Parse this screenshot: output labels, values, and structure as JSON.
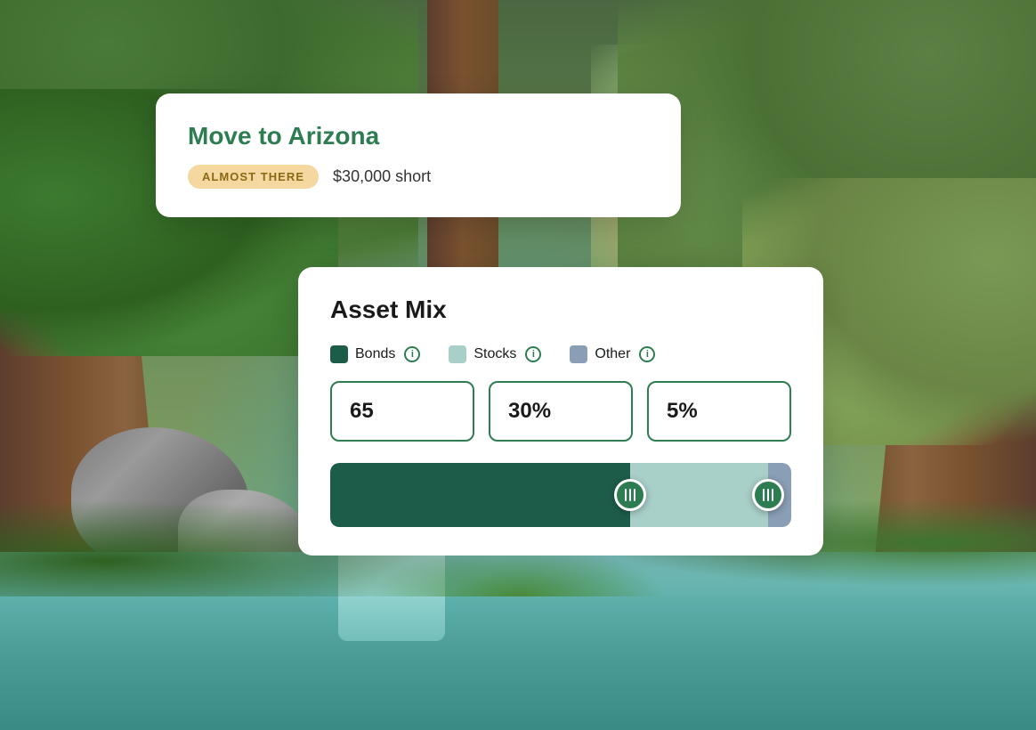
{
  "background": {
    "alt": "Forest with waterfall background"
  },
  "goal_card": {
    "title": "Move to Arizona",
    "status_badge": "ALMOST THERE",
    "short_amount": "$30,000 short"
  },
  "asset_card": {
    "title": "Asset Mix",
    "legend": {
      "bonds_label": "Bonds",
      "stocks_label": "Stocks",
      "other_label": "Other"
    },
    "bonds_value": "65",
    "stocks_value": "30%",
    "other_value": "5%",
    "bonds_pct": 65,
    "stocks_pct": 30,
    "other_pct": 5,
    "info_symbol": "i",
    "bonds_color": "#1e5c4a",
    "stocks_color": "#a8cfc8",
    "other_color": "#8a9eb5",
    "handle1_left_pct": 65,
    "handle2_left_pct": 95
  }
}
